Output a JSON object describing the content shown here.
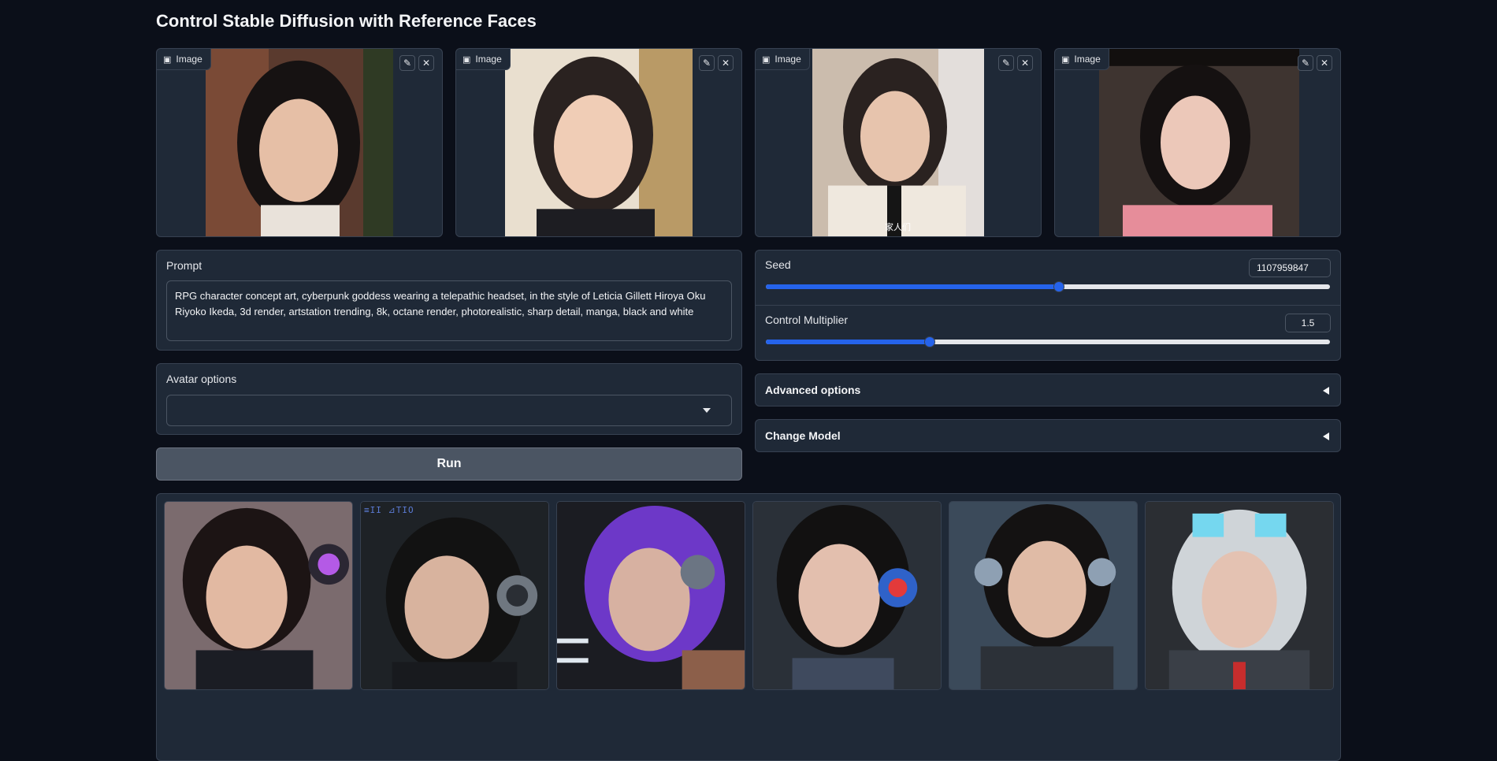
{
  "app": {
    "title": "Control Stable Diffusion with Reference Faces"
  },
  "inputs": {
    "image_label": "Image",
    "edit_icon": "pencil-icon",
    "clear_icon": "close-icon",
    "shirt_text": "家人们"
  },
  "prompt": {
    "label": "Prompt",
    "value": "RPG character concept art, cyberpunk goddess wearing a telepathic headset, in the style of Leticia Gillett Hiroya Oku Riyoko Ikeda, 3d render, artstation trending, 8k, octane render, photorealistic, sharp detail, manga, black and white"
  },
  "avatar": {
    "label": "Avatar options",
    "value": ""
  },
  "run": {
    "label": "Run"
  },
  "seed": {
    "label": "Seed",
    "value": "1107959847",
    "fraction": 0.52
  },
  "control": {
    "label": "Control Multiplier",
    "value": "1.5",
    "fraction": 0.29
  },
  "advanced": {
    "label": "Advanced options"
  },
  "change_model": {
    "label": "Change Model"
  },
  "gallery": {
    "watermark": "≡II ⊿TIO"
  },
  "colors": {
    "accent": "#2563eb",
    "background": "#0b0f19",
    "panel": "#1f2937"
  }
}
